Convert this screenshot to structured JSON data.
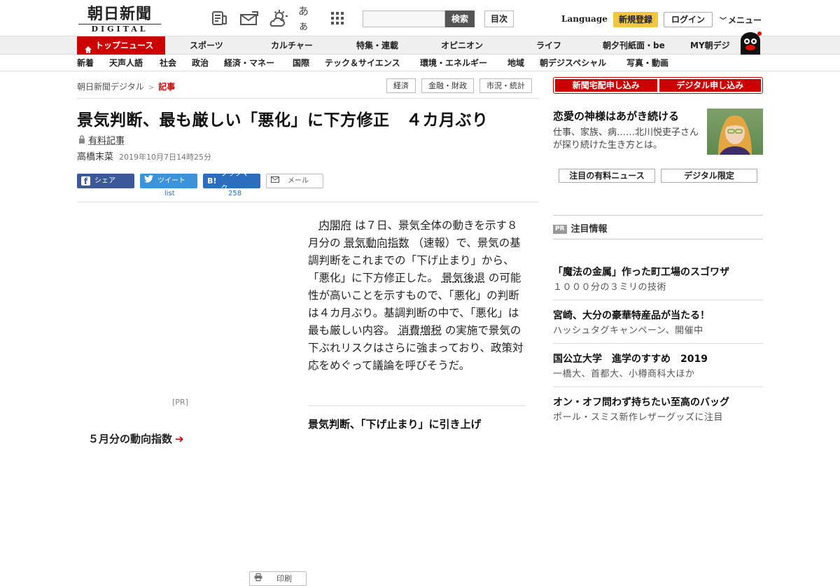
{
  "header": {
    "logo_line1": "朝日新聞",
    "logo_line2": "DIGITAL",
    "icons": [
      "newspaper-icon",
      "mail-icon",
      "weather-icon",
      "font-size-icon",
      "grid-icon"
    ],
    "font_icon_text": "あぁ",
    "search_placeholder": "",
    "search_button": "検索",
    "index_button": "目次",
    "language": "Language",
    "register": "新規登録",
    "login": "ログイン",
    "menu": "メニュー"
  },
  "nav_primary": {
    "top": "トップニュース",
    "items": [
      "スポーツ",
      "カルチャー",
      "特集・連載",
      "オピニオン",
      "ライフ",
      "朝夕刊紙面・be",
      "MY朝デジ"
    ]
  },
  "nav_secondary": {
    "items": [
      "新着",
      "天声人語",
      "社会",
      "政治",
      "経済・マネー",
      "国際",
      "テック＆サイエンス",
      "環境・エネルギー",
      "地域",
      "朝デジスペシャル",
      "写真・動画"
    ]
  },
  "breadcrumb": {
    "home": "朝日新聞デジタル",
    "separator": ">",
    "current": "記事"
  },
  "tags": [
    "経済",
    "金融・財政",
    "市況・統計"
  ],
  "article": {
    "title": "景気判断、最も厳しい「悪化」に下方修正　４カ月ぶり",
    "paid_label": "有料記事",
    "author": "高橋末菜",
    "date": "2019年10月7日14時25分",
    "share": {
      "facebook": "シェア",
      "twitter": "ツイート",
      "hatena": "ブックマーク",
      "mail": "メール",
      "print": "印刷",
      "twitter_count": "list",
      "hatena_count": "258"
    },
    "body": {
      "link1": "内閣府",
      "t1": " は７日、景気全体の動きを示す８月分の ",
      "link2": "景気動向指数",
      "t2": " （速報）で、景気の基調判断をこれまでの「下げ止まり」から、「悪化」に下方修正した。 ",
      "link3": "景気後退",
      "t3": " の可能性が高いことを示すもので、「悪化」の判断は４カ月ぶり。基調判断の中で、「悪化」は最も厳しい内容。 ",
      "link4": "消費増税",
      "t4": " の実施で景気の下ぶれリスクはさらに強まっており、政策対応をめぐって議論を呼びそうだ。"
    },
    "related": "景気判断、「下げ止まり」に引き上げ",
    "ad_label": "[PR]",
    "side_link": "５月分の動向指数"
  },
  "sidebar": {
    "cta": [
      "新聞宅配申し込み",
      "デジタル申し込み"
    ],
    "feature": {
      "headline": "恋愛の神様はあがき続ける",
      "sub": "仕事、家族、病……北川悦吏子さんが探り続けた生き方とは。"
    },
    "tabs": [
      "注目の有料ニュース",
      "デジタル限定"
    ],
    "pr_badge": "PR",
    "pr_heading": "注目情報",
    "pr_items": [
      {
        "headline": "「魔法の金属」作った町工場のスゴワザ",
        "sub": "１０００分の３ミリの技術"
      },
      {
        "headline": "宮崎、大分の豪華特産品が当たる！",
        "sub": "ハッシュタグキャンペーン、開催中"
      },
      {
        "headline": "国公立大学　進学のすすめ　2019",
        "sub": "一橋大、首都大、小樽商科大ほか"
      },
      {
        "headline": "オン・オフ問わず持ちたい至高のバッグ",
        "sub": "ポール・スミス新作レザーグッズに注目"
      }
    ]
  },
  "colors": {
    "brand_red": "#cc0000",
    "register_yellow": "#f2c740",
    "facebook": "#3b5998",
    "twitter": "#3b94d9",
    "hatena": "#2c6ebd"
  }
}
